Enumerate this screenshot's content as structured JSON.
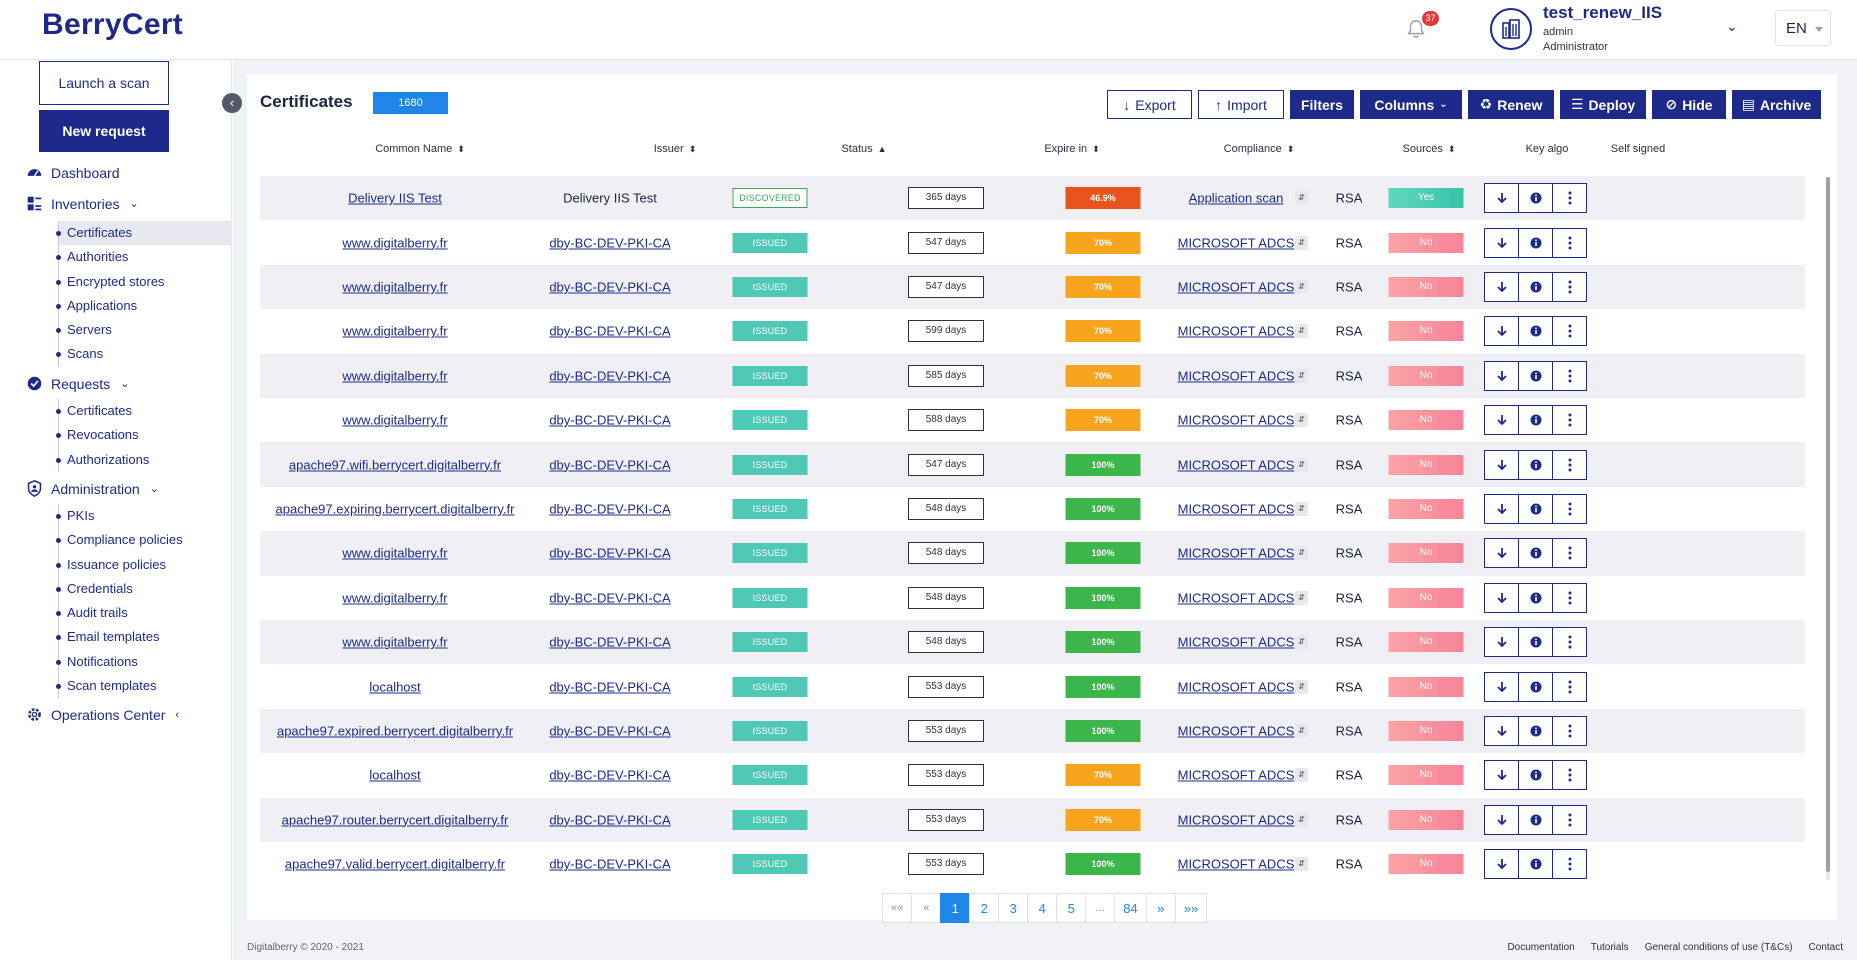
{
  "app": {
    "logo": "BerryCert"
  },
  "header": {
    "notifications_count": "37",
    "user_name": "test_renew_IIS",
    "user_login": "admin",
    "user_role": "Administrator",
    "language": "EN"
  },
  "sidebar": {
    "launch_scan": "Launch a scan",
    "new_request": "New request",
    "dashboard": "Dashboard",
    "inventories": {
      "label": "Inventories",
      "items": [
        "Certificates",
        "Authorities",
        "Encrypted stores",
        "Applications",
        "Servers",
        "Scans"
      ]
    },
    "requests": {
      "label": "Requests",
      "items": [
        "Certificates",
        "Revocations",
        "Authorizations"
      ]
    },
    "administration": {
      "label": "Administration",
      "items": [
        "PKIs",
        "Compliance policies",
        "Issuance policies",
        "Credentials",
        "Audit trails",
        "Email templates",
        "Notifications",
        "Scan templates"
      ]
    },
    "operations_center": "Operations Center"
  },
  "page": {
    "title": "Certificates",
    "count": "1680",
    "toolbar": {
      "export": "Export",
      "import": "Import",
      "filters": "Filters",
      "columns": "Columns",
      "renew": "Renew",
      "deploy": "Deploy",
      "hide": "Hide",
      "archive": "Archive"
    }
  },
  "table": {
    "columns": [
      "Common Name",
      "Issuer",
      "Status",
      "Expire in",
      "Compliance",
      "Sources",
      "Key algo",
      "Self signed"
    ],
    "rows": [
      {
        "common_name": "Delivery IIS Test",
        "issuer": "Delivery IIS Test",
        "issuer_link": false,
        "status": "DISCOVERED",
        "expire_in": "365 days",
        "compliance": "46.9%",
        "compliance_color": "#e8541c",
        "source": "Application scan",
        "key_algo": "RSA",
        "self_signed": "Yes"
      },
      {
        "common_name": "www.digitalberry.fr",
        "issuer": "dby-BC-DEV-PKI-CA",
        "issuer_link": true,
        "status": "ISSUED",
        "expire_in": "547 days",
        "compliance": "70%",
        "compliance_color": "#f7a51d",
        "source": "MICROSOFT ADCS",
        "key_algo": "RSA",
        "self_signed": "No"
      },
      {
        "common_name": "www.digitalberry.fr",
        "issuer": "dby-BC-DEV-PKI-CA",
        "issuer_link": true,
        "status": "ISSUED",
        "expire_in": "547 days",
        "compliance": "70%",
        "compliance_color": "#f7a51d",
        "source": "MICROSOFT ADCS",
        "key_algo": "RSA",
        "self_signed": "No"
      },
      {
        "common_name": "www.digitalberry.fr",
        "issuer": "dby-BC-DEV-PKI-CA",
        "issuer_link": true,
        "status": "ISSUED",
        "expire_in": "599 days",
        "compliance": "70%",
        "compliance_color": "#f7a51d",
        "source": "MICROSOFT ADCS",
        "key_algo": "RSA",
        "self_signed": "No"
      },
      {
        "common_name": "www.digitalberry.fr",
        "issuer": "dby-BC-DEV-PKI-CA",
        "issuer_link": true,
        "status": "ISSUED",
        "expire_in": "585 days",
        "compliance": "70%",
        "compliance_color": "#f7a51d",
        "source": "MICROSOFT ADCS",
        "key_algo": "RSA",
        "self_signed": "No"
      },
      {
        "common_name": "www.digitalberry.fr",
        "issuer": "dby-BC-DEV-PKI-CA",
        "issuer_link": true,
        "status": "ISSUED",
        "expire_in": "588 days",
        "compliance": "70%",
        "compliance_color": "#f7a51d",
        "source": "MICROSOFT ADCS",
        "key_algo": "RSA",
        "self_signed": "No"
      },
      {
        "common_name": "apache97.wifi.berrycert.digitalberry.fr",
        "issuer": "dby-BC-DEV-PKI-CA",
        "issuer_link": true,
        "status": "ISSUED",
        "expire_in": "547 days",
        "compliance": "100%",
        "compliance_color": "#3cb54a",
        "source": "MICROSOFT ADCS",
        "key_algo": "RSA",
        "self_signed": "No"
      },
      {
        "common_name": "apache97.expiring.berrycert.digitalberry.fr",
        "issuer": "dby-BC-DEV-PKI-CA",
        "issuer_link": true,
        "status": "ISSUED",
        "expire_in": "548 days",
        "compliance": "100%",
        "compliance_color": "#3cb54a",
        "source": "MICROSOFT ADCS",
        "key_algo": "RSA",
        "self_signed": "No"
      },
      {
        "common_name": "www.digitalberry.fr",
        "issuer": "dby-BC-DEV-PKI-CA",
        "issuer_link": true,
        "status": "ISSUED",
        "expire_in": "548 days",
        "compliance": "100%",
        "compliance_color": "#3cb54a",
        "source": "MICROSOFT ADCS",
        "key_algo": "RSA",
        "self_signed": "No"
      },
      {
        "common_name": "www.digitalberry.fr",
        "issuer": "dby-BC-DEV-PKI-CA",
        "issuer_link": true,
        "status": "ISSUED",
        "expire_in": "548 days",
        "compliance": "100%",
        "compliance_color": "#3cb54a",
        "source": "MICROSOFT ADCS",
        "key_algo": "RSA",
        "self_signed": "No"
      },
      {
        "common_name": "www.digitalberry.fr",
        "issuer": "dby-BC-DEV-PKI-CA",
        "issuer_link": true,
        "status": "ISSUED",
        "expire_in": "548 days",
        "compliance": "100%",
        "compliance_color": "#3cb54a",
        "source": "MICROSOFT ADCS",
        "key_algo": "RSA",
        "self_signed": "No"
      },
      {
        "common_name": "localhost",
        "issuer": "dby-BC-DEV-PKI-CA",
        "issuer_link": true,
        "status": "ISSUED",
        "expire_in": "553 days",
        "compliance": "100%",
        "compliance_color": "#3cb54a",
        "source": "MICROSOFT ADCS",
        "key_algo": "RSA",
        "self_signed": "No"
      },
      {
        "common_name": "apache97.expired.berrycert.digitalberry.fr",
        "issuer": "dby-BC-DEV-PKI-CA",
        "issuer_link": true,
        "status": "ISSUED",
        "expire_in": "553 days",
        "compliance": "100%",
        "compliance_color": "#3cb54a",
        "source": "MICROSOFT ADCS",
        "key_algo": "RSA",
        "self_signed": "No"
      },
      {
        "common_name": "localhost",
        "issuer": "dby-BC-DEV-PKI-CA",
        "issuer_link": true,
        "status": "ISSUED",
        "expire_in": "553 days",
        "compliance": "70%",
        "compliance_color": "#f7a51d",
        "source": "MICROSOFT ADCS",
        "key_algo": "RSA",
        "self_signed": "No"
      },
      {
        "common_name": "apache97.router.berrycert.digitalberry.fr",
        "issuer": "dby-BC-DEV-PKI-CA",
        "issuer_link": true,
        "status": "ISSUED",
        "expire_in": "553 days",
        "compliance": "70%",
        "compliance_color": "#f7a51d",
        "source": "MICROSOFT ADCS",
        "key_algo": "RSA",
        "self_signed": "No"
      },
      {
        "common_name": "apache97.valid.berrycert.digitalberry.fr",
        "issuer": "dby-BC-DEV-PKI-CA",
        "issuer_link": true,
        "status": "ISSUED",
        "expire_in": "553 days",
        "compliance": "100%",
        "compliance_color": "#3cb54a",
        "source": "MICROSOFT ADCS",
        "key_algo": "RSA",
        "self_signed": "No"
      }
    ]
  },
  "pagination": {
    "first": "««",
    "prev": "«",
    "pages": [
      "1",
      "2",
      "3",
      "4",
      "5",
      "...",
      "84"
    ],
    "current": "1",
    "next": "»",
    "last": "»»"
  },
  "footer": {
    "copyright": "Digitalberry © 2020 - 2021",
    "links": [
      "Documentation",
      "Tutorials",
      "General conditions of use (T&Cs)",
      "Contact"
    ]
  },
  "colors": {
    "brand": "#1d2a8a",
    "accent": "#1f86e8",
    "issued": "#4fc9b6",
    "self_signed_yes": "#3fcfb2",
    "self_signed_no": "#f98a95"
  }
}
